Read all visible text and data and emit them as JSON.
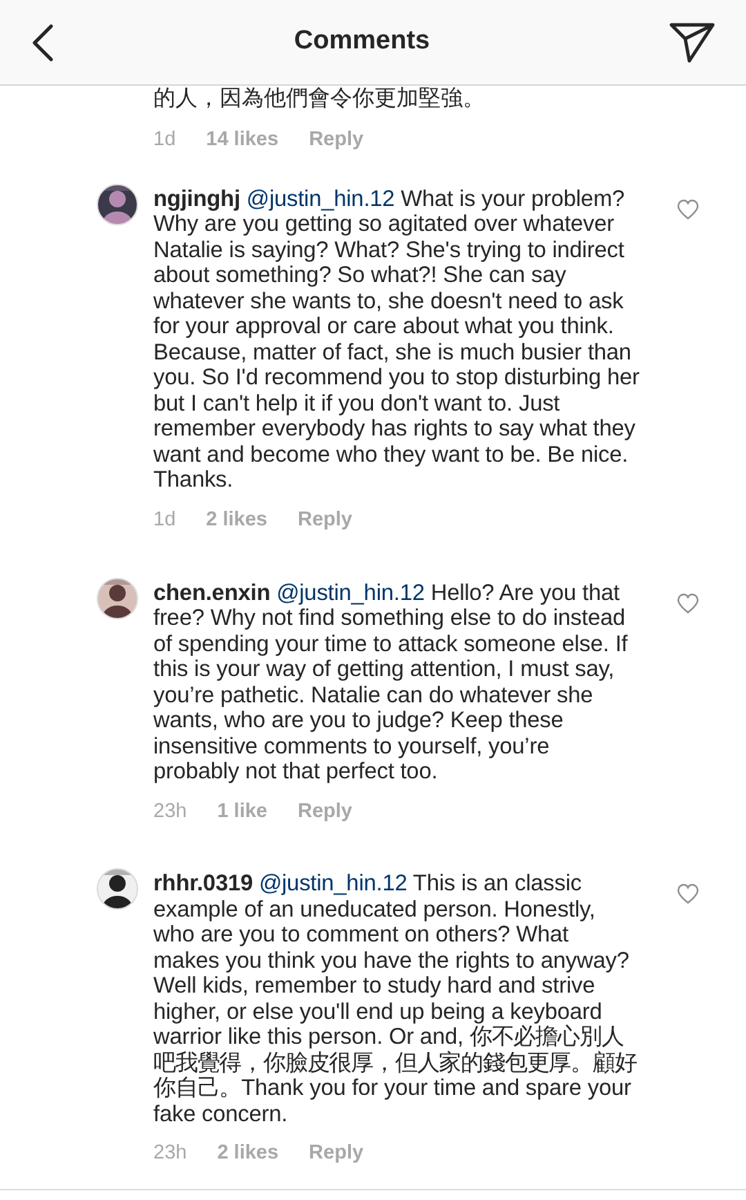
{
  "header": {
    "title": "Comments"
  },
  "cut_comment": {
    "text": "的人，因為他們會令你更加堅強。",
    "time": "1d",
    "likes": "14 likes",
    "reply": "Reply"
  },
  "comments": [
    {
      "username": "ngjinghj",
      "mention": "@justin_hin.12",
      "text": "What is your problem? Why are you getting so agitated over whatever Natalie is saying? What? She's trying to indirect about something? So what?! She can say whatever she wants to, she doesn't need to ask for your approval or care about what you think. Because, matter of fact, she is much busier than you. So I'd recommend you to stop disturbing her but I can't help it if you don't want to. Just remember everybody has rights to say what they want and become who they want to be. Be nice. Thanks.",
      "time": "1d",
      "likes": "2 likes",
      "reply": "Reply",
      "liked": false
    },
    {
      "username": "chen.enxin",
      "mention": "@justin_hin.12",
      "text": "Hello? Are you that free? Why not find something else to do instead of spending your time to attack someone else. If this is your way of getting attention, I must say, you’re pathetic. Natalie can do whatever she wants, who are you to judge? Keep these insensitive comments to yourself, you’re probably not that perfect too.",
      "time": "23h",
      "likes": "1 like",
      "reply": "Reply",
      "liked": false
    },
    {
      "username": "rhhr.0319",
      "mention": "@justin_hin.12",
      "text": "This is an classic example of an uneducated person. Honestly, who are you to comment on others? What makes you think you have the rights to anyway? Well kids, remember to study hard and strive higher, or else you'll end up being a keyboard warrior like this person. Or and, 你不必擔心別人吧我覺得，你臉皮很厚，但人家的錢包更厚。顧好你自己。Thank you for your time and spare your fake concern.",
      "time": "23h",
      "likes": "2 likes",
      "reply": "Reply",
      "liked": false
    }
  ]
}
